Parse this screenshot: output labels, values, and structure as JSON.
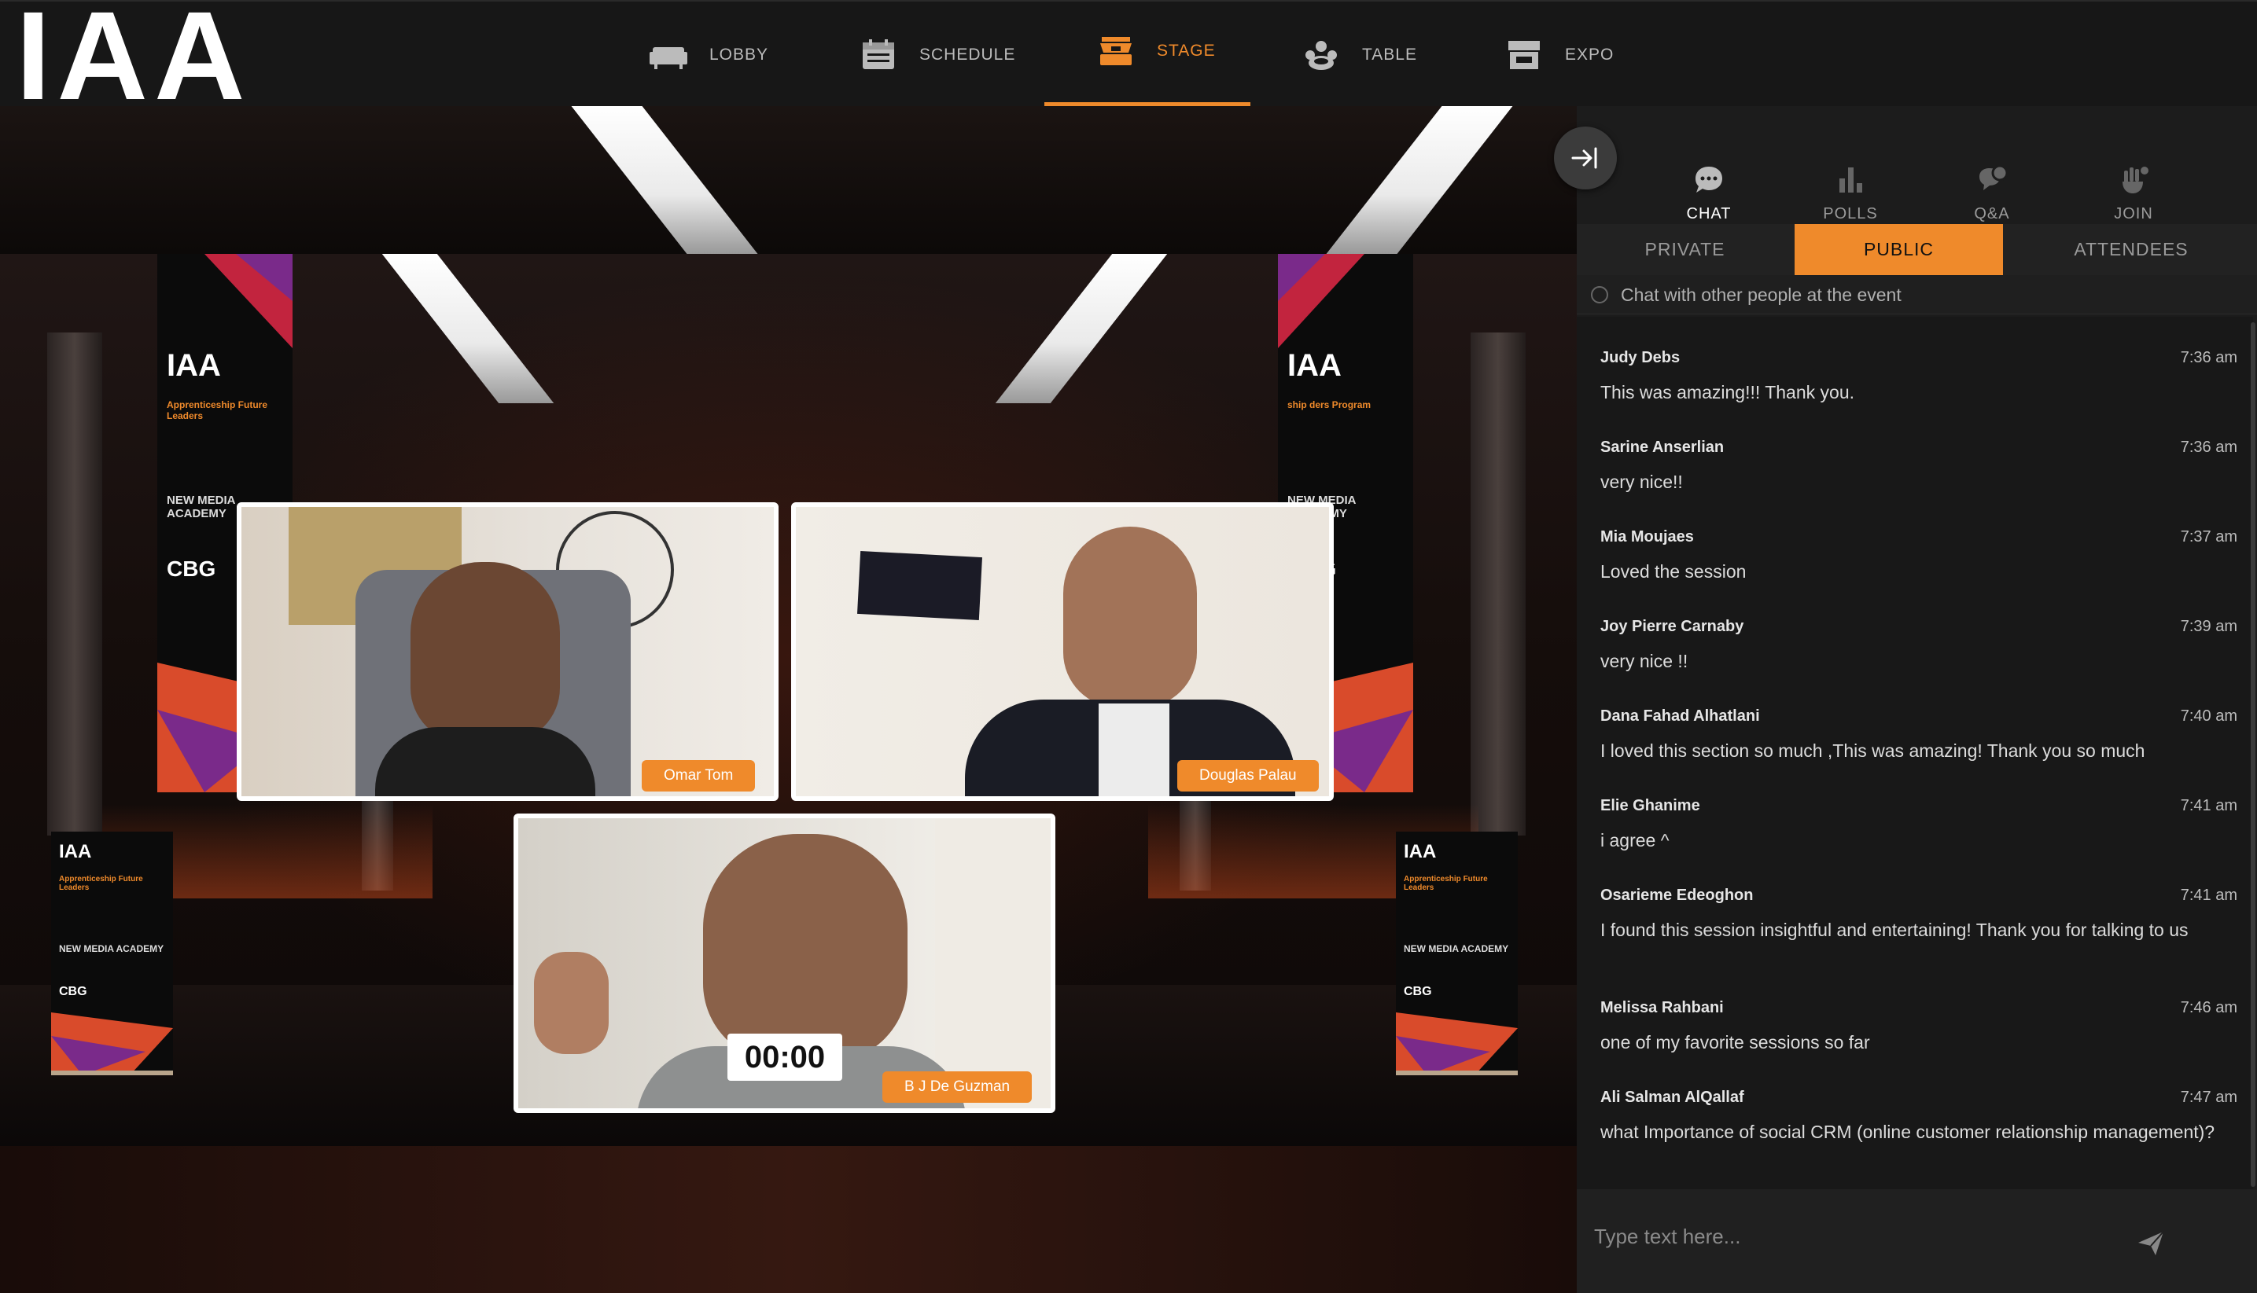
{
  "brand": {
    "logo_text": "IAA",
    "accent": "#ef8a2b"
  },
  "nav": {
    "items": [
      {
        "label": "LOBBY",
        "icon": "sofa-icon"
      },
      {
        "label": "SCHEDULE",
        "icon": "calendar-icon"
      },
      {
        "label": "STAGE",
        "icon": "stage-icon",
        "active": true
      },
      {
        "label": "TABLE",
        "icon": "table-icon"
      },
      {
        "label": "EXPO",
        "icon": "booth-icon"
      }
    ]
  },
  "stage": {
    "banner_logo": "IAA",
    "banner_title": "Apprenticeship Future Leaders",
    "banner_right_title": "ship ders Program",
    "banner_partner": "NEW MEDIA ACADEMY",
    "banner_cbg": "CBG",
    "videos": [
      {
        "name": "Omar Tom"
      },
      {
        "name": "Douglas Palau"
      },
      {
        "name": "B J De Guzman"
      }
    ],
    "timer": "00:00"
  },
  "panel": {
    "tabs": [
      {
        "label": "CHAT",
        "icon": "chat-icon",
        "active": true
      },
      {
        "label": "POLLS",
        "icon": "poll-icon"
      },
      {
        "label": "Q&A",
        "icon": "qa-icon"
      },
      {
        "label": "JOIN",
        "icon": "raise-hand-icon"
      }
    ],
    "subtabs": [
      {
        "label": "PRIVATE"
      },
      {
        "label": "PUBLIC",
        "active": true
      },
      {
        "label": "ATTENDEES"
      }
    ],
    "hint": "Chat with other people at the event",
    "messages": [
      {
        "name": "Judy Debs",
        "time": "7:36 am",
        "text": "This was amazing!!! Thank you."
      },
      {
        "name": "Sarine Anserlian",
        "time": "7:36 am",
        "text": "very nice!!"
      },
      {
        "name": "Mia Moujaes",
        "time": "7:37 am",
        "text": "Loved the session"
      },
      {
        "name": "Joy Pierre Carnaby",
        "time": "7:39 am",
        "text": "very nice !!"
      },
      {
        "name": "Dana Fahad Alhatlani",
        "time": "7:40 am",
        "text": "I loved this section so much ,This was amazing! Thank you so much"
      },
      {
        "name": "Elie Ghanime",
        "time": "7:41 am",
        "text": "i agree ^"
      },
      {
        "name": "Osarieme Edeoghon",
        "time": "7:41 am",
        "text": "I found this session insightful and entertaining! Thank you for talking to us"
      },
      {
        "name": "Melissa Rahbani",
        "time": "7:46 am",
        "text": "one of my favorite sessions so far"
      },
      {
        "name": "Ali Salman AlQallaf",
        "time": "7:47 am",
        "text": "what Importance of social CRM (online customer relationship management)?"
      }
    ],
    "composer": {
      "placeholder": "Type text here..."
    }
  }
}
